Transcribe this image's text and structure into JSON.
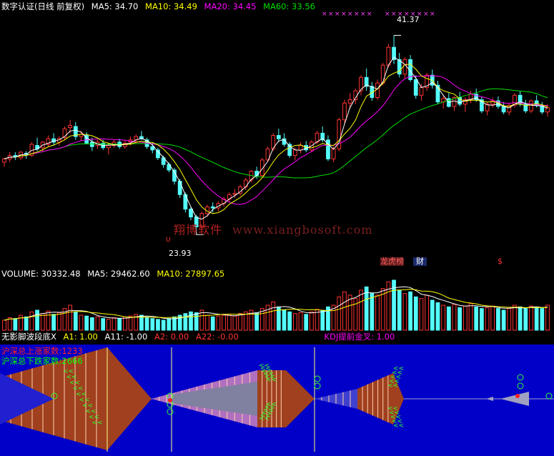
{
  "colors": {
    "bg": "#000000",
    "up": "#ff3333",
    "down": "#54fcfc",
    "ma5": "#ffffff",
    "ma10": "#ffff00",
    "ma20": "#ff00ff",
    "ma60": "#00e000",
    "indicator_bg": "#0000c8",
    "brown": "#a0401e",
    "grid": "#8a0000"
  },
  "price_legend": {
    "title": "数字认证(日线 前复权)",
    "ma5": "MA5: 34.70",
    "ma10": "MA10: 34.49",
    "ma20": "MA20: 34.45",
    "ma60": "MA60: 33.56"
  },
  "price_annotations": {
    "high_label": "41.37",
    "low_label": "23.93",
    "low_marker": "U",
    "tag_ranking": "龙虎榜",
    "tag_finance": "财",
    "tag_dollar": "$"
  },
  "watermark": {
    "cn": "翔博软件",
    "url": "www.xiangbosoft.com"
  },
  "volume_legend": {
    "volume": "VOLUME: 30332.48",
    "ma5": "MA5: 29462.60",
    "ma10": "MA10: 27897.65"
  },
  "indicator_legend": {
    "name": "无影脚波段底X",
    "a1": "A1: 1.00",
    "a11": "A11: -1.00",
    "a2": "A2: 0.00",
    "a22": "A22: -0.00",
    "kdj": "KDJ提前金叉: 1.00"
  },
  "indicator_overlay": {
    "up_count": "沪深总上涨家数:1233",
    "down_count": "沪深总下跌家数:2666"
  },
  "chart_data": {
    "type": "candlestick",
    "price_range": [
      21.8,
      43.0
    ],
    "candles": [
      [
        30.0,
        30.4,
        29.6,
        30.3
      ],
      [
        30.3,
        30.9,
        30.0,
        30.6
      ],
      [
        30.6,
        30.9,
        30.2,
        30.5
      ],
      [
        30.4,
        31.0,
        30.2,
        30.9
      ],
      [
        30.8,
        31.0,
        30.3,
        30.7
      ],
      [
        30.6,
        31.8,
        30.5,
        31.6
      ],
      [
        31.5,
        32.2,
        31.0,
        31.2
      ],
      [
        31.3,
        31.9,
        31.0,
        31.8
      ],
      [
        31.6,
        32.4,
        31.4,
        32.1
      ],
      [
        32.1,
        32.6,
        31.5,
        31.8
      ],
      [
        31.8,
        32.3,
        31.5,
        32.1
      ],
      [
        32.2,
        33.2,
        32.0,
        33.0
      ],
      [
        33.1,
        33.8,
        32.6,
        33.3
      ],
      [
        33.2,
        33.6,
        32.0,
        32.3
      ],
      [
        32.3,
        32.8,
        31.9,
        32.5
      ],
      [
        32.4,
        32.7,
        31.6,
        31.7
      ],
      [
        31.8,
        32.2,
        31.0,
        31.4
      ],
      [
        31.5,
        32.0,
        31.2,
        31.8
      ],
      [
        31.7,
        32.0,
        31.1,
        31.3
      ],
      [
        31.3,
        31.7,
        30.7,
        31.5
      ],
      [
        31.5,
        32.0,
        31.3,
        31.8
      ],
      [
        31.8,
        32.1,
        31.2,
        31.4
      ],
      [
        31.4,
        32.0,
        31.2,
        31.7
      ],
      [
        31.8,
        32.3,
        31.5,
        32.0
      ],
      [
        32.0,
        32.5,
        31.7,
        32.3
      ],
      [
        32.3,
        32.8,
        32.0,
        32.1
      ],
      [
        32.0,
        32.2,
        31.2,
        31.4
      ],
      [
        31.4,
        31.8,
        30.8,
        31.1
      ],
      [
        31.1,
        31.3,
        30.2,
        30.4
      ],
      [
        30.4,
        30.6,
        29.5,
        29.8
      ],
      [
        29.8,
        30.0,
        29.1,
        29.3
      ],
      [
        29.3,
        29.5,
        28.0,
        28.3
      ],
      [
        28.3,
        28.5,
        26.8,
        27.1
      ],
      [
        27.1,
        27.3,
        25.5,
        25.8
      ],
      [
        25.8,
        26.0,
        24.8,
        25.1
      ],
      [
        25.1,
        25.3,
        23.9,
        24.2
      ],
      [
        24.2,
        25.6,
        23.93,
        25.4
      ],
      [
        25.4,
        26.2,
        25.1,
        26.0
      ],
      [
        26.0,
        26.4,
        25.5,
        25.9
      ],
      [
        25.9,
        26.5,
        25.6,
        26.3
      ],
      [
        26.3,
        26.9,
        26.0,
        26.7
      ],
      [
        26.7,
        27.3,
        26.4,
        27.1
      ],
      [
        27.1,
        27.6,
        26.8,
        27.2
      ],
      [
        27.2,
        28.0,
        27.0,
        27.8
      ],
      [
        27.8,
        28.6,
        27.5,
        28.4
      ],
      [
        28.4,
        29.3,
        28.2,
        29.2
      ],
      [
        29.2,
        29.6,
        28.5,
        28.8
      ],
      [
        28.8,
        30.4,
        28.7,
        30.2
      ],
      [
        30.2,
        31.4,
        30.0,
        31.2
      ],
      [
        31.2,
        32.6,
        31.0,
        32.4
      ],
      [
        32.4,
        33.0,
        31.8,
        32.1
      ],
      [
        32.1,
        32.6,
        31.4,
        31.6
      ],
      [
        31.6,
        31.8,
        30.4,
        30.6
      ],
      [
        30.6,
        31.3,
        30.2,
        31.1
      ],
      [
        31.1,
        31.8,
        30.8,
        31.5
      ],
      [
        31.5,
        31.9,
        30.9,
        31.1
      ],
      [
        31.1,
        32.0,
        30.9,
        31.8
      ],
      [
        31.8,
        32.8,
        31.6,
        32.6
      ],
      [
        32.6,
        33.2,
        31.8,
        32.0
      ],
      [
        32.0,
        32.4,
        30.1,
        30.3
      ],
      [
        30.3,
        31.4,
        30.0,
        31.2
      ],
      [
        31.2,
        34.0,
        31.0,
        33.8
      ],
      [
        33.8,
        35.6,
        33.5,
        35.3
      ],
      [
        35.3,
        36.2,
        34.8,
        35.6
      ],
      [
        35.6,
        36.6,
        35.2,
        36.4
      ],
      [
        36.4,
        37.8,
        36.0,
        37.6
      ],
      [
        37.6,
        38.4,
        36.4,
        36.8
      ],
      [
        36.8,
        37.2,
        35.5,
        35.8
      ],
      [
        35.8,
        37.4,
        35.6,
        37.1
      ],
      [
        37.1,
        38.9,
        36.9,
        38.7
      ],
      [
        38.7,
        40.6,
        38.5,
        40.3
      ],
      [
        40.3,
        41.37,
        38.8,
        39.2
      ],
      [
        39.2,
        39.8,
        37.6,
        37.9
      ],
      [
        37.9,
        39.4,
        37.5,
        39.2
      ],
      [
        39.2,
        39.6,
        37.2,
        37.4
      ],
      [
        37.4,
        37.8,
        35.7,
        36.0
      ],
      [
        36.0,
        37.0,
        35.5,
        36.7
      ],
      [
        36.7,
        38.0,
        36.4,
        37.8
      ],
      [
        37.8,
        38.3,
        36.6,
        36.9
      ],
      [
        36.9,
        37.3,
        35.2,
        35.4
      ],
      [
        35.4,
        36.0,
        34.8,
        35.7
      ],
      [
        35.7,
        36.2,
        34.9,
        35.0
      ],
      [
        35.0,
        35.9,
        34.6,
        35.8
      ],
      [
        35.8,
        36.3,
        35.0,
        35.2
      ],
      [
        35.2,
        35.8,
        34.5,
        35.6
      ],
      [
        35.6,
        36.4,
        35.3,
        36.1
      ],
      [
        36.1,
        36.6,
        35.4,
        35.6
      ],
      [
        35.6,
        35.9,
        34.4,
        34.6
      ],
      [
        34.6,
        35.4,
        34.2,
        35.2
      ],
      [
        35.2,
        35.8,
        34.9,
        35.5
      ],
      [
        35.5,
        35.9,
        34.8,
        35.0
      ],
      [
        35.0,
        35.4,
        34.3,
        34.5
      ],
      [
        34.5,
        35.3,
        34.2,
        35.1
      ],
      [
        35.1,
        36.2,
        34.9,
        36.0
      ],
      [
        36.0,
        36.4,
        35.0,
        35.2
      ],
      [
        35.2,
        35.6,
        34.4,
        34.6
      ],
      [
        34.6,
        35.6,
        34.4,
        35.5
      ],
      [
        35.5,
        36.0,
        34.9,
        35.1
      ],
      [
        35.1,
        35.4,
        34.3,
        34.5
      ],
      [
        34.5,
        35.2,
        34.1,
        34.9
      ]
    ],
    "volume": [
      12,
      15,
      14,
      18,
      16,
      22,
      24,
      20,
      23,
      19,
      21,
      26,
      30,
      22,
      18,
      17,
      15,
      16,
      14,
      13,
      15,
      14,
      16,
      17,
      19,
      18,
      15,
      14,
      13,
      12,
      14,
      16,
      18,
      20,
      22,
      21,
      24,
      18,
      16,
      17,
      18,
      19,
      17,
      20,
      22,
      24,
      21,
      26,
      30,
      34,
      28,
      24,
      22,
      20,
      21,
      19,
      22,
      25,
      24,
      28,
      30,
      40,
      46,
      42,
      38,
      48,
      52,
      44,
      42,
      50,
      58,
      60,
      48,
      44,
      46,
      40,
      38,
      42,
      36,
      33,
      30,
      28,
      31,
      27,
      29,
      32,
      28,
      26,
      27,
      29,
      26,
      24,
      26,
      30,
      28,
      26,
      29,
      27,
      26,
      30
    ],
    "volume_range": [
      0,
      60
    ]
  }
}
